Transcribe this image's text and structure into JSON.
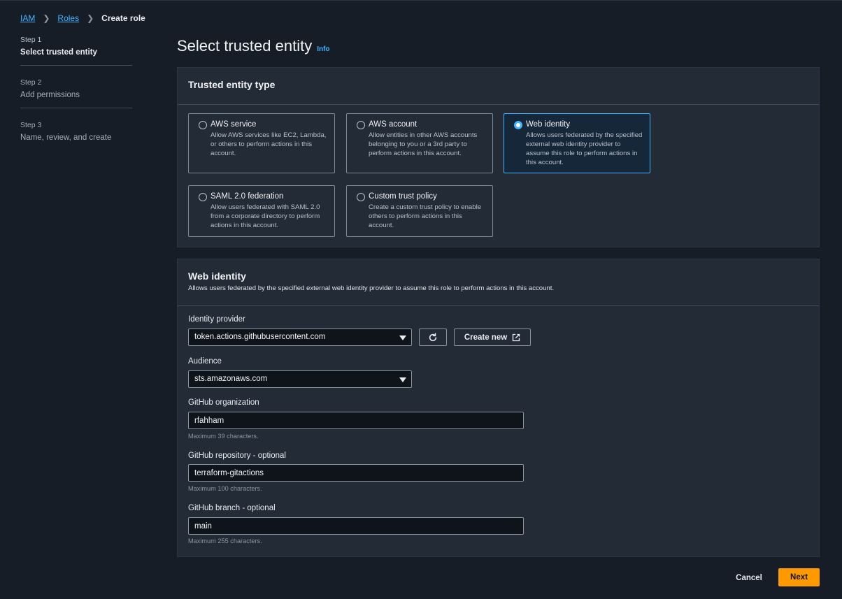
{
  "breadcrumb": {
    "items": [
      "IAM",
      "Roles"
    ],
    "current": "Create role"
  },
  "steps": [
    {
      "number": "Step 1",
      "title": "Select trusted entity",
      "active": true
    },
    {
      "number": "Step 2",
      "title": "Add permissions",
      "active": false
    },
    {
      "number": "Step 3",
      "title": "Name, review, and create",
      "active": false
    }
  ],
  "page": {
    "title": "Select trusted entity",
    "info_label": "Info"
  },
  "entity_panel": {
    "title": "Trusted entity type",
    "selected": "Web identity",
    "options": [
      {
        "title": "AWS service",
        "desc": "Allow AWS services like EC2, Lambda, or others to perform actions in this account."
      },
      {
        "title": "AWS account",
        "desc": "Allow entities in other AWS accounts belonging to you or a 3rd party to perform actions in this account."
      },
      {
        "title": "Web identity",
        "desc": "Allows users federated by the specified external web identity provider to assume this role to perform actions in this account."
      },
      {
        "title": "SAML 2.0 federation",
        "desc": "Allow users federated with SAML 2.0 from a corporate directory to perform actions in this account."
      },
      {
        "title": "Custom trust policy",
        "desc": "Create a custom trust policy to enable others to perform actions in this account."
      }
    ]
  },
  "web_identity_panel": {
    "title": "Web identity",
    "description": "Allows users federated by the specified external web identity provider to assume this role to perform actions in this account.",
    "identity_provider": {
      "label": "Identity provider",
      "value": "token.actions.githubusercontent.com",
      "create_new_label": "Create new"
    },
    "audience": {
      "label": "Audience",
      "value": "sts.amazonaws.com"
    },
    "github_org": {
      "label": "GitHub organization",
      "value": "rfahham",
      "hint": "Maximum 39 characters."
    },
    "github_repo": {
      "label": "GitHub repository - optional",
      "value": "terraform-gitactions",
      "hint": "Maximum 100 characters."
    },
    "github_branch": {
      "label": "GitHub branch - optional",
      "value": "main",
      "hint": "Maximum 255 characters."
    }
  },
  "footer": {
    "cancel_label": "Cancel",
    "next_label": "Next"
  },
  "colors": {
    "background": "#161d26",
    "panel": "#232b37",
    "accent": "#42b4ff",
    "primary_button": "#ff9900"
  },
  "icons": [
    "chevron-right-icon",
    "refresh-icon",
    "external-link-icon",
    "caret-down-icon"
  ]
}
